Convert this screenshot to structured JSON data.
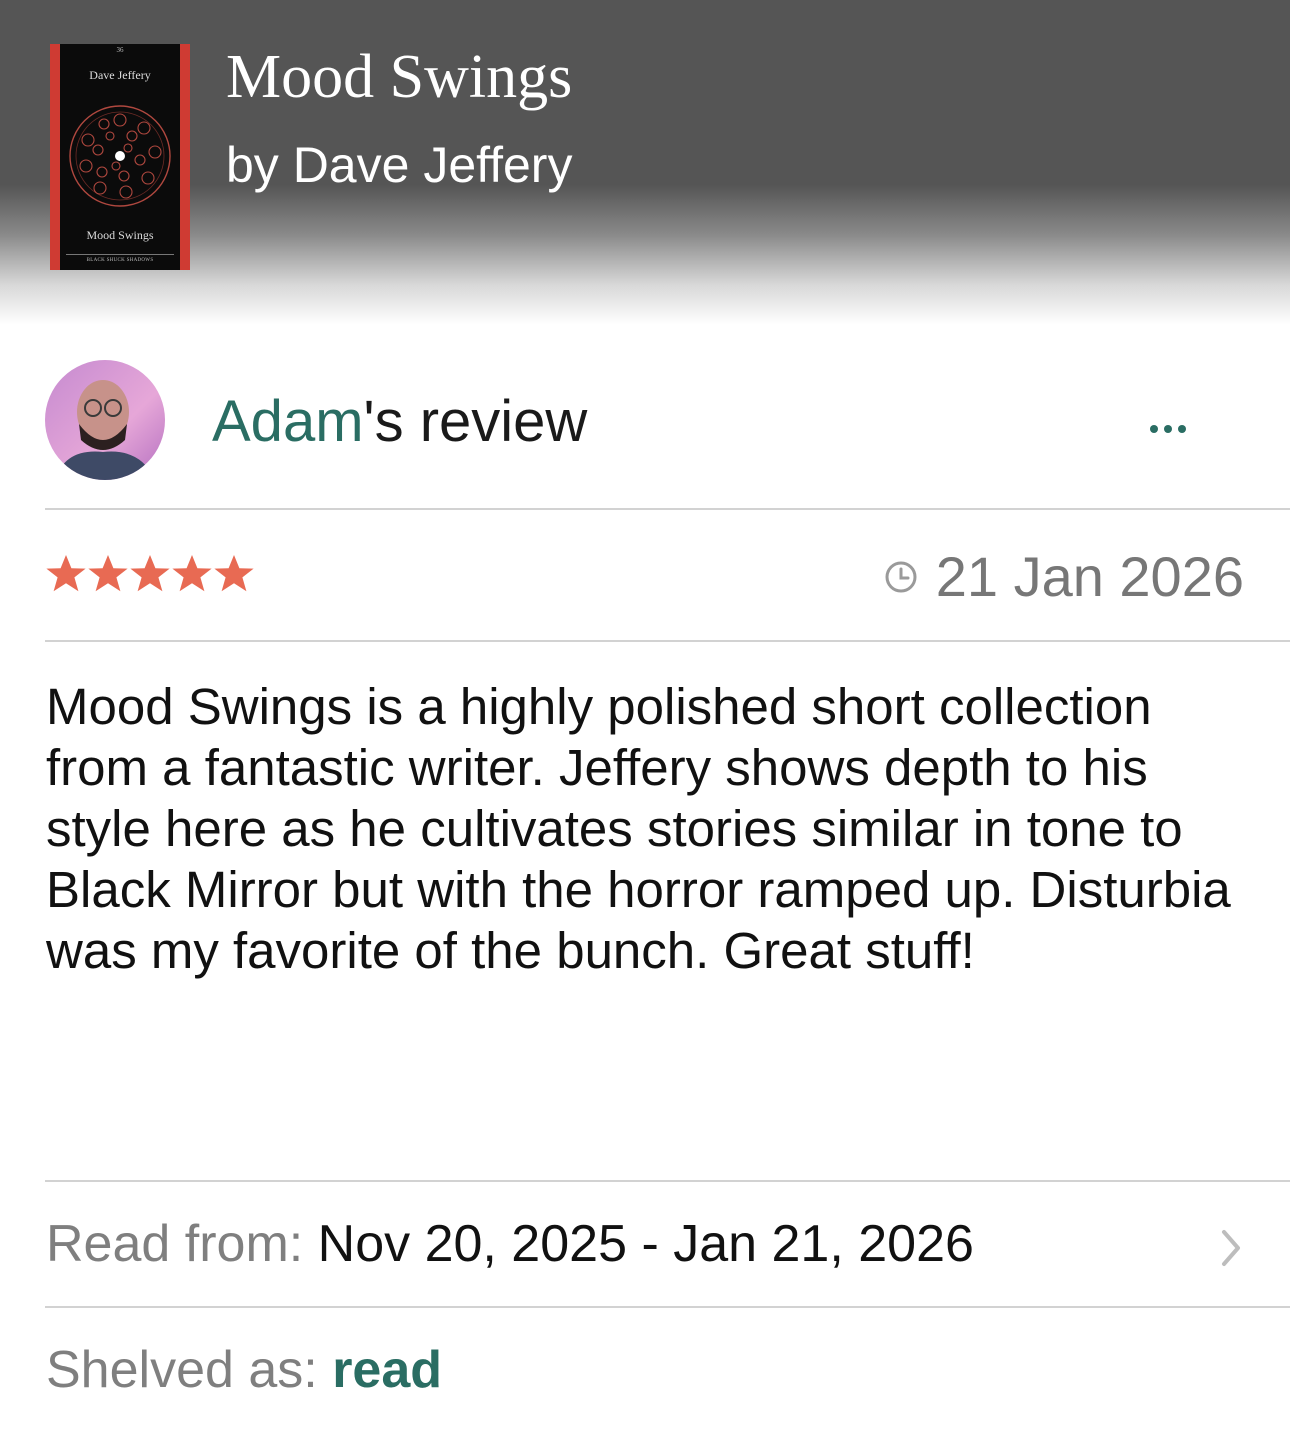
{
  "book": {
    "title": "Mood Swings",
    "author_line": "by Dave Jeffery",
    "cover": {
      "number": "36",
      "author": "Dave Jeffery",
      "title": "Mood Swings",
      "publisher": "BLACK SHUCK SHADOWS"
    }
  },
  "review": {
    "reviewer_name": "Adam",
    "heading_suffix": "'s review",
    "more_icon": "more-horizontal-icon",
    "rating": 5,
    "max_rating": 5,
    "date_icon": "clock-icon",
    "date": "21 Jan 2026",
    "body": "Mood Swings is a highly polished short collection from a fantastic writer. Jeffery shows depth to his style here as he cultivates stories similar in tone to Black Mirror but with the horror ramped up. Disturbia was my favorite of the bunch. Great stuff!"
  },
  "read_dates": {
    "label": "Read from: ",
    "value": "Nov 20, 2025 - Jan 21, 2026",
    "chevron_icon": "chevron-right-icon"
  },
  "shelf": {
    "label": "Shelved as: ",
    "value": "read"
  },
  "colors": {
    "accent": "#2a6d63",
    "star": "#e86a53",
    "header_bg": "#555555"
  }
}
